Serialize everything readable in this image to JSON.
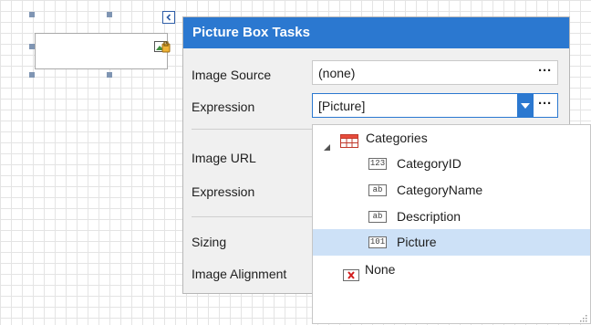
{
  "panel": {
    "title": "Picture Box Tasks",
    "image_source_label": "Image Source",
    "image_source_value": "(none)",
    "expression_label": "Expression",
    "expression_value": "[Picture]",
    "image_url_label": "Image URL",
    "expression2_label": "Expression",
    "sizing_label": "Sizing",
    "image_alignment_label": "Image Alignment",
    "ellipsis": "···"
  },
  "tree": {
    "root": "Categories",
    "fields": [
      {
        "icon": "123",
        "label": "CategoryID"
      },
      {
        "icon": "ab",
        "label": "CategoryName"
      },
      {
        "icon": "ab",
        "label": "Description"
      },
      {
        "icon": "101",
        "label": "Picture"
      }
    ],
    "none_label": "None"
  },
  "colors": {
    "accent": "#2b78d0",
    "selection": "#cde1f7",
    "none_icon": "#d21f1f"
  }
}
